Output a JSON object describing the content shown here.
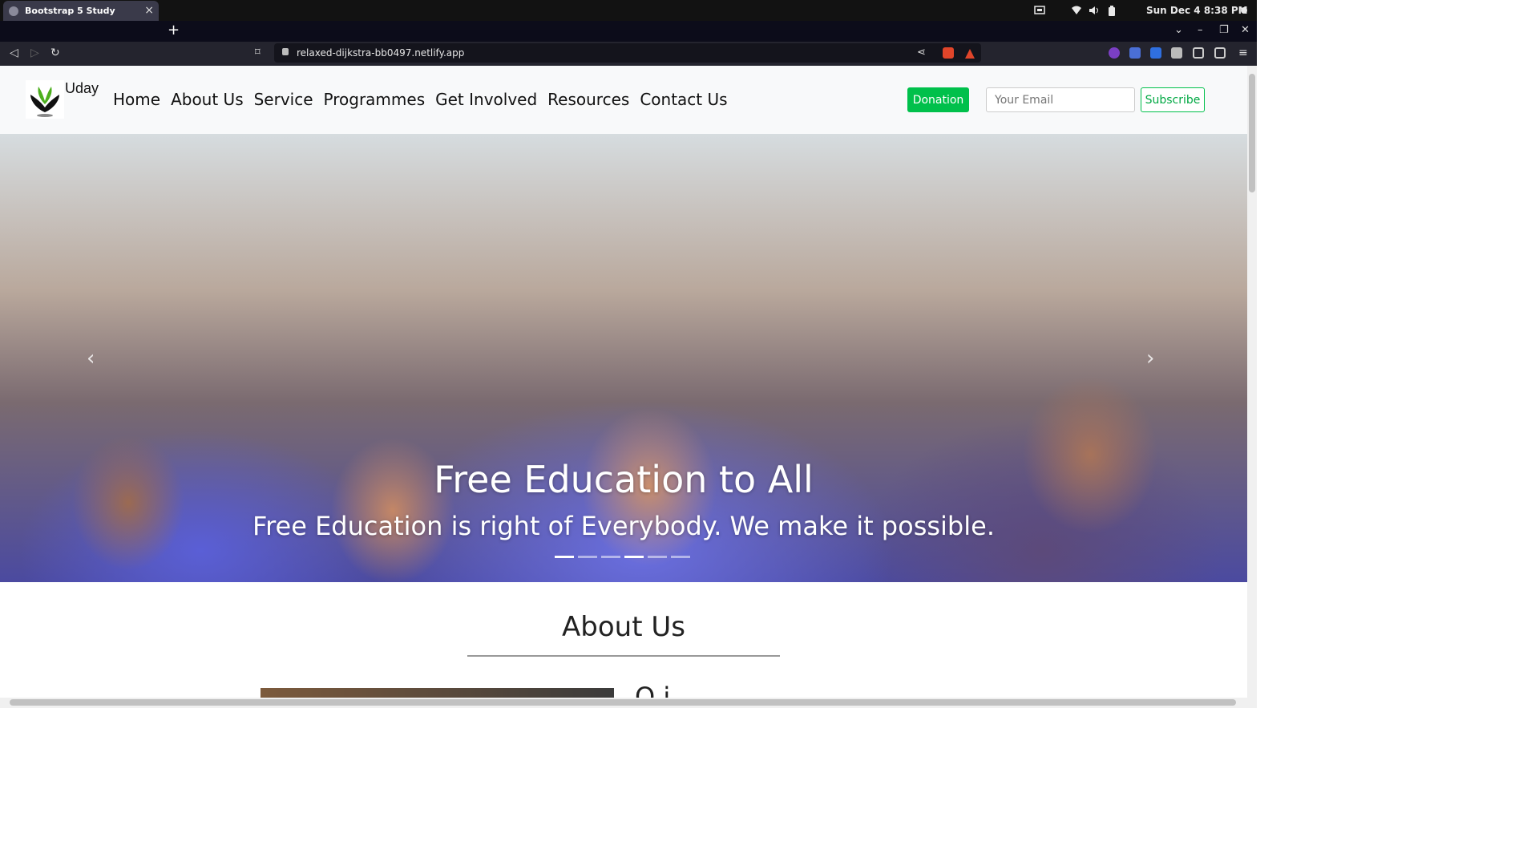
{
  "os": {
    "clock": "Sun Dec 4   8:38 PM"
  },
  "browser": {
    "tab_title": "Bootstrap 5 Study",
    "url": "relaxed-dijkstra-bb0497.netlify.app"
  },
  "site": {
    "brand": "Uday",
    "nav": [
      "Home",
      "About Us",
      "Service",
      "Programmes",
      "Get Involved",
      "Resources",
      "Contact Us"
    ],
    "donation_label": "Donation",
    "email_placeholder": "Your Email",
    "subscribe_label": "Subscribe"
  },
  "carousel": {
    "title": "Free Education to All",
    "text": "Free Education is right of Everybody. We make it possible.",
    "slide_count": 6,
    "active_index": 0
  },
  "about": {
    "title": "About Us",
    "subtitle": "O   i"
  },
  "colors": {
    "donation_bg": "#00c04b",
    "subscribe_border": "#00c04b"
  }
}
